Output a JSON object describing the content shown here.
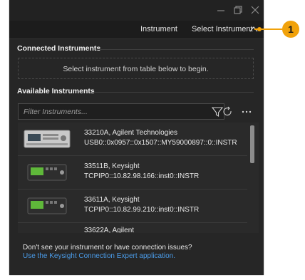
{
  "window": {
    "controls": {
      "minimize_icon": "minimize-icon",
      "restore_icon": "restore-icon",
      "close_icon": "close-icon"
    }
  },
  "tabs": {
    "instrument": "Instrument",
    "select_instrument": "Select Instrument"
  },
  "connected": {
    "heading": "Connected Instruments",
    "empty_message": "Select instrument from table below to begin."
  },
  "available": {
    "heading": "Available Instruments",
    "filter_placeholder": "Filter Instruments...",
    "items": [
      {
        "title": "33210A, Agilent Technologies",
        "address": "USB0::0x0957::0x1507::MY59000897::0::INSTR"
      },
      {
        "title": "33511B, Keysight",
        "address": "TCPIP0::10.82.98.166::inst0::INSTR"
      },
      {
        "title": "33611A, Keysight",
        "address": "TCPIP0::10.82.99.210::inst0::INSTR"
      },
      {
        "title": "33622A, Agilent",
        "address": ""
      }
    ]
  },
  "footer": {
    "question": "Don't see your instrument or have connection issues?",
    "link": "Use the Keysight Connection Expert application."
  },
  "callout": {
    "number": "1",
    "color": "#f1a20b"
  },
  "colors": {
    "accent_link": "#4a9be8",
    "window_bg": "#262626"
  }
}
